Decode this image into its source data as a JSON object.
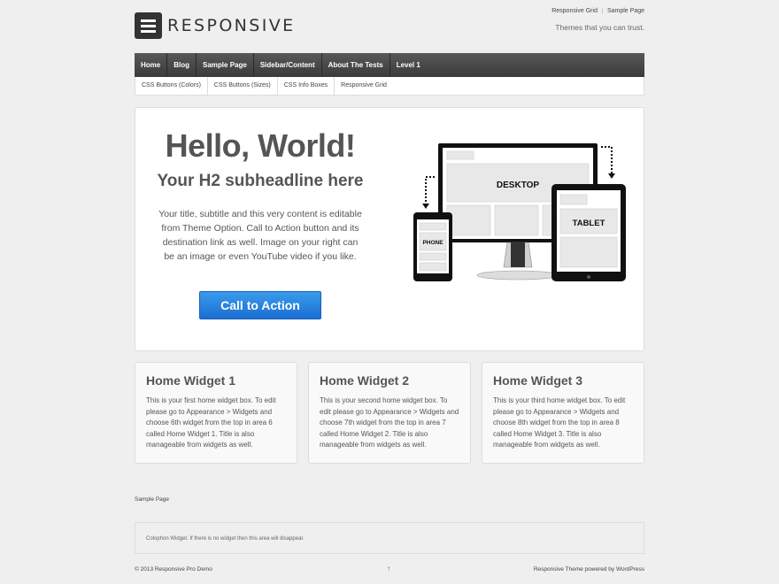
{
  "header": {
    "logo_text": "RESPONSIVE",
    "top_links": [
      "Responsive Grid",
      "Sample Page"
    ],
    "tagline": "Themes that you can trust."
  },
  "main_menu": [
    "Home",
    "Blog",
    "Sample Page",
    "Sidebar/Content",
    "About The Tests",
    "Level 1"
  ],
  "sub_menu": [
    "CSS Buttons (Colors)",
    "CSS Buttons (Sizes)",
    "CSS Info Boxes",
    "Responsive Grid"
  ],
  "featured": {
    "title": "Hello, World!",
    "subtitle": "Your H2 subheadline here",
    "text": "Your title, subtitle and this very content is editable from Theme Option. Call to Action button and its destination link as well. Image on your right can be an image or even YouTube video if you like.",
    "cta_label": "Call to Action",
    "devices": {
      "desktop": "DESKTOP",
      "tablet": "TABLET",
      "phone": "PHONE"
    }
  },
  "widgets": [
    {
      "title": "Home Widget 1",
      "text": "This is your first home widget box. To edit please go to Appearance > Widgets and choose 6th widget from the top in area 6 called Home Widget 1. Title is also manageable from widgets as well."
    },
    {
      "title": "Home Widget 2",
      "text": "This is your second home widget box. To edit please go to Appearance > Widgets and choose 7th widget from the top in area 7 called Home Widget 2. Title is also manageable from widgets as well."
    },
    {
      "title": "Home Widget 3",
      "text": "This is your third home widget box. To edit please go to Appearance > Widgets and choose 8th widget from the top in area 8 called Home Widget 3. Title is also manageable from widgets as well."
    }
  ],
  "footer": {
    "menu_item": "Sample Page",
    "colophon": "Colophon Widget. If there is no widget then this area will disappear.",
    "copyright": "© 2013 Responsive Pro Demo",
    "scroll_top": "↑",
    "powered_theme": "Responsive Theme",
    "powered_text": " powered by ",
    "powered_wp": "WordPress"
  },
  "colors": {
    "cta": "#1c6ed2",
    "menu": "#3a3a3a",
    "background": "#efefef"
  }
}
